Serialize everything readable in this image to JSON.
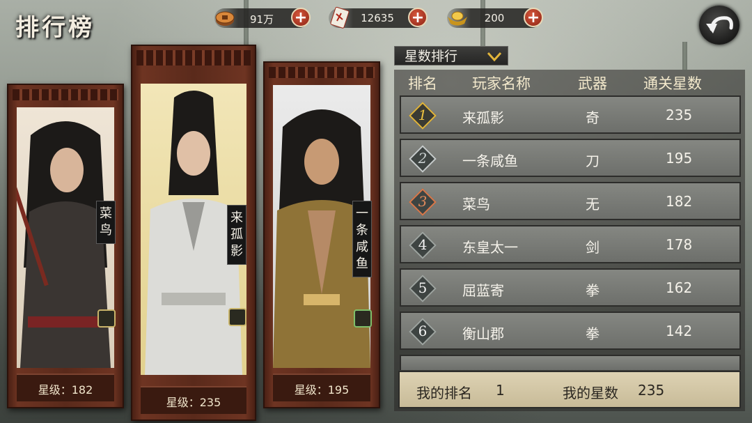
{
  "screen": {
    "title": "排行榜"
  },
  "resources": [
    {
      "name": "coins",
      "icon": "coin-icon",
      "value": "91万"
    },
    {
      "name": "talisman",
      "icon": "talisman-card-icon",
      "value": "12635"
    },
    {
      "name": "ingot",
      "icon": "gold-ingot-icon",
      "value": "200"
    }
  ],
  "podium": [
    {
      "rank": 3,
      "name_chars": [
        "菜",
        "鸟"
      ],
      "stars_label": "星级：182"
    },
    {
      "rank": 1,
      "name_chars": [
        "来",
        "孤",
        "影"
      ],
      "stars_label": "星级：235"
    },
    {
      "rank": 2,
      "name_chars": [
        "一",
        "条",
        "咸",
        "鱼"
      ],
      "stars_label": "星级：195"
    }
  ],
  "sort": {
    "label": "星数排行"
  },
  "table": {
    "headers": [
      "排名",
      "玩家名称",
      "武器",
      "通关星数"
    ],
    "rows": [
      {
        "rank": "1",
        "name": "来孤影",
        "weapon": "奇",
        "stars": "235"
      },
      {
        "rank": "2",
        "name": "一条咸鱼",
        "weapon": "刀",
        "stars": "195"
      },
      {
        "rank": "3",
        "name": "菜鸟",
        "weapon": "无",
        "stars": "182"
      },
      {
        "rank": "4",
        "name": "东皇太一",
        "weapon": "剑",
        "stars": "178"
      },
      {
        "rank": "5",
        "name": "屈蓝寄",
        "weapon": "拳",
        "stars": "162"
      },
      {
        "rank": "6",
        "name": "衡山郡",
        "weapon": "拳",
        "stars": "142"
      }
    ]
  },
  "mine": {
    "rank_label": "我的排名",
    "rank_value": "1",
    "stars_label": "我的星数",
    "stars_value": "235"
  },
  "colors": {
    "gold": "#e2b53a",
    "silver": "#c7cccc",
    "bronze": "#d9784a",
    "frame": "#5a2a1b"
  }
}
